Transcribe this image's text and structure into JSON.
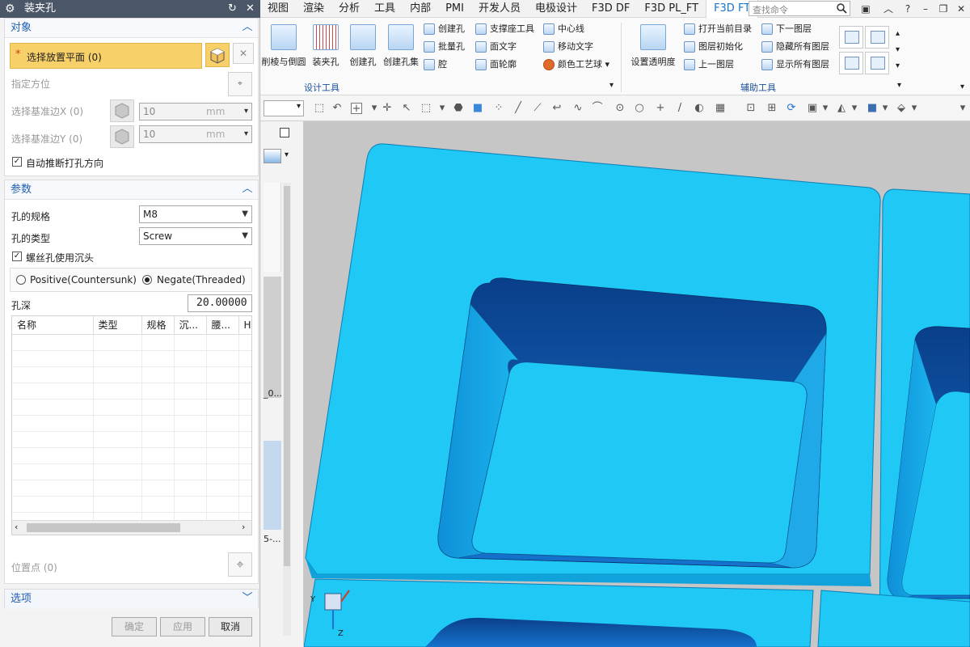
{
  "dialog": {
    "title": "装夹孔",
    "sections": {
      "object": {
        "title": "对象",
        "select_face_label": "选择放置平面 (0)",
        "required_marker": "*",
        "specify_orientation": "指定方位",
        "select_ref_x": "选择基准边X (0)",
        "select_ref_y": "选择基准边Y (0)",
        "ref_x_value": "10",
        "ref_x_unit": "mm",
        "ref_y_value": "10",
        "ref_y_unit": "mm",
        "auto_infer_label": "自动推断打孔方向"
      },
      "params": {
        "title": "参数",
        "hole_spec_label": "孔的规格",
        "hole_spec_value": "M8",
        "hole_type_label": "孔的类型",
        "hole_type_value": "Screw",
        "countersink_label": "螺丝孔使用沉头",
        "radio_positive": "Positive(Countersunk)",
        "radio_negate": "Negate(Threaded)",
        "depth_label": "孔深",
        "depth_value": "20.00000",
        "table_headers": [
          "名称",
          "类型",
          "规格",
          "沉...",
          "腰...",
          "H"
        ],
        "position_point": "位置点 (0)"
      },
      "options": {
        "title": "选项"
      }
    },
    "buttons": {
      "ok": "确定",
      "apply": "应用",
      "cancel": "取消"
    }
  },
  "menubar": {
    "items": [
      "视图",
      "渲染",
      "分析",
      "工具",
      "内部",
      "PMI",
      "开发人员",
      "电极设计",
      "F3D DF",
      "F3D PL_FT",
      "F3D FT"
    ],
    "active": "F3D FT",
    "search_placeholder": "查找命令"
  },
  "ribbon": {
    "design_tools": {
      "label": "设计工具",
      "big": [
        "削棱与倒圆",
        "装夹孔",
        "创建孔",
        "创建孔集"
      ],
      "small": [
        "创建孔",
        "批量孔",
        "腔",
        "支撑座工具",
        "面文字",
        "面轮廓",
        "中心线",
        "移动文字",
        "颜色工艺球"
      ]
    },
    "aux_tools": {
      "label": "辅助工具",
      "big": [
        "设置透明度"
      ],
      "small": [
        "打开当前目录",
        "图层初始化",
        "上一图层",
        "下一图层",
        "隐藏所有图层",
        "显示所有图层"
      ]
    }
  },
  "navigator": {
    "item1": "_0...",
    "item2": "5-..."
  },
  "viewport": {
    "axis_y": "Y",
    "axis_z": "Z",
    "model_color": "#1ec8f5"
  }
}
